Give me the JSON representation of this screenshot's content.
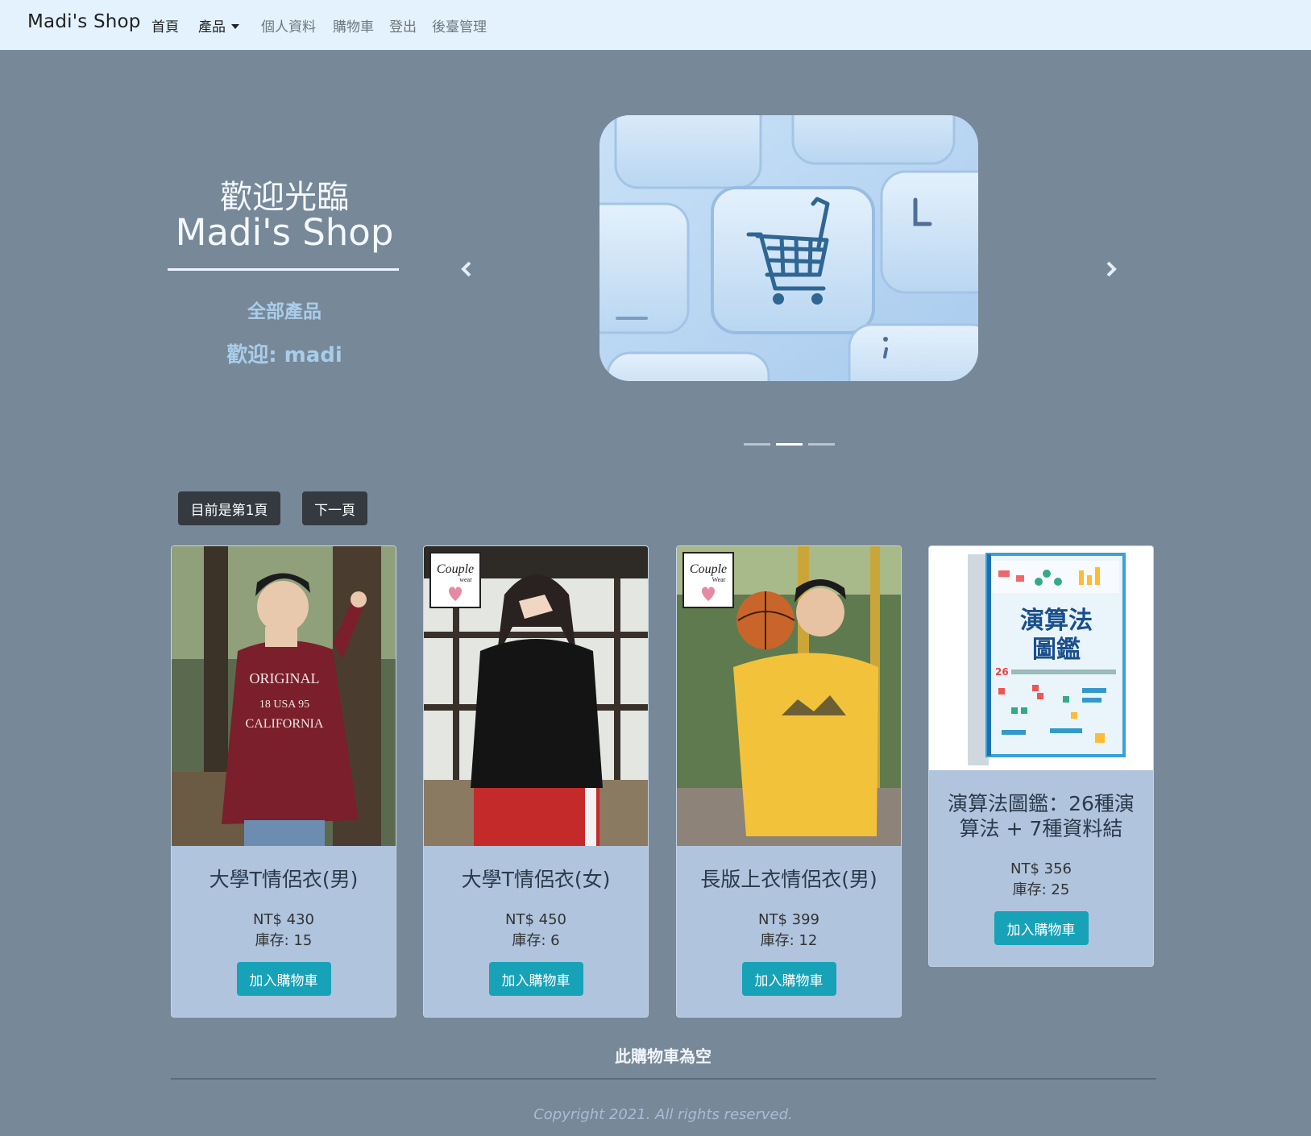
{
  "navbar": {
    "brand": "Madi's Shop",
    "items": [
      {
        "label": "首頁"
      },
      {
        "label": "產品"
      },
      {
        "label": "個人資料"
      },
      {
        "label": "購物車"
      },
      {
        "label": "登出"
      },
      {
        "label": "後臺管理"
      }
    ]
  },
  "hero": {
    "welcome": "歡迎光臨",
    "shop_name": "Madi's Shop",
    "all_products": "全部產品",
    "greeting": "歡迎: madi"
  },
  "carousel": {
    "image": "shopping-cart-key-image",
    "slides": 3,
    "active_slide": 2
  },
  "pager": {
    "current_page": "目前是第1頁",
    "next_page": "下一頁"
  },
  "products": [
    {
      "name": "大學T情侶衣(男)",
      "price": "NT$ 430",
      "stock": "庫存: 15",
      "button": "加入購物車",
      "image": "man-maroon-sweatshirt-photo"
    },
    {
      "name": "大學T情侶衣(女)",
      "price": "NT$ 450",
      "stock": "庫存: 6",
      "button": "加入購物車",
      "image": "woman-black-hoodie-photo"
    },
    {
      "name": "長版上衣情侶衣(男)",
      "price": "NT$ 399",
      "stock": "庫存: 12",
      "button": "加入購物車",
      "image": "man-yellow-tshirt-basketball-photo"
    },
    {
      "name": "演算法圖鑑：26種演算法 + 7種資料結",
      "price": "NT$ 356",
      "stock": "庫存: 25",
      "button": "加入購物車",
      "image": "algorithm-book-cover"
    }
  ],
  "book_cover": {
    "title_line1": "演算法",
    "title_line2": "圖鑑"
  },
  "cart": {
    "empty_message": "此購物車為空"
  },
  "footer": {
    "copyright": "Copyright 2021. All rights reserved."
  },
  "colors": {
    "background": "#778899",
    "navbar": "#e3f2fd",
    "card": "#b0c4de",
    "add_button": "#17a2b8",
    "dark_button": "#343a40"
  }
}
